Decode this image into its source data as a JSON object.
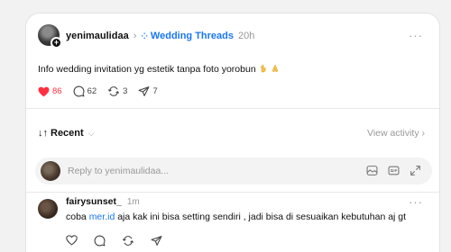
{
  "post": {
    "username": "yenimaulidaa",
    "separator": "›",
    "topic_icon": "⁘",
    "topic": "Wedding Threads",
    "time": "20h",
    "more": "···",
    "text": "Info wedding invitation yg estetik tanpa foto yorobun",
    "emojis": [
      "hand-gesture-emoji",
      "pray-emoji"
    ],
    "likes": "86",
    "comments": "62",
    "reposts": "3",
    "shares": "7"
  },
  "sort": {
    "arrows": "↓↑",
    "label": "Recent",
    "chevron": "⌵",
    "view_activity": "View activity ›"
  },
  "reply": {
    "placeholder": "Reply to yenimaulidaa..."
  },
  "comment": {
    "username": "fairysunset_",
    "time": "1m",
    "more": "···",
    "text_before": "coba ",
    "link": "mer.id",
    "text_after": " aja kak ini bisa setting sendiri , jadi bisa di sesuaikan kebutuhan aj gt"
  },
  "colors": {
    "accent": "#1877f2",
    "like": "#ff3040",
    "muted": "#999999"
  }
}
